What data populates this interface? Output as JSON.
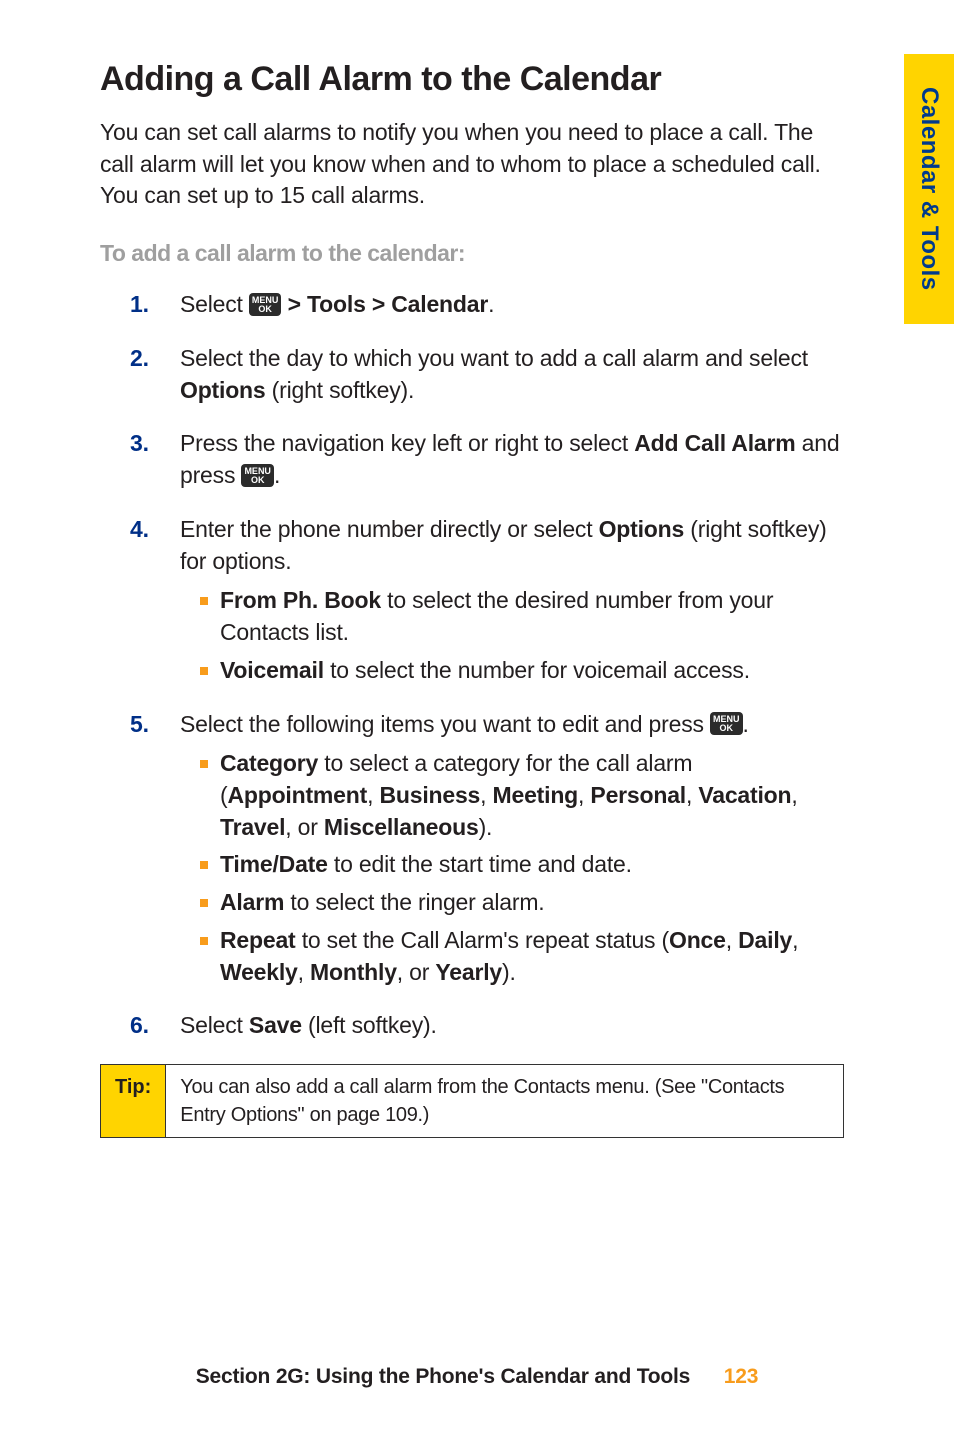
{
  "sideTab": "Calendar & Tools",
  "title": "Adding a Call Alarm to the Calendar",
  "intro": "You can set call alarms to notify you when you need to place a call. The call alarm will let you know when and to whom to place a scheduled call. You can set up to 15 call alarms.",
  "subheading": "To add a call alarm to the calendar:",
  "menuIcon": {
    "top": "MENU",
    "bot": "OK"
  },
  "steps": {
    "s1": {
      "prefix": "Select ",
      "suffix": " > Tools > Calendar",
      "trail": "."
    },
    "s2": {
      "l1": "Select the day to which you want to add a call alarm and select ",
      "opt": "Options",
      "l2": " (right softkey)."
    },
    "s3": {
      "l1": "Press the navigation key left or right to select ",
      "add": "Add Call Alarm",
      "l2": " and press ",
      "trail": "."
    },
    "s4": {
      "l1": "Enter the phone number directly or select ",
      "opt": "Options",
      "l2": " (right softkey) for options.",
      "a": {
        "bold": "From Ph. Book",
        "rest": " to select the desired number from your Contacts list."
      },
      "b": {
        "bold": "Voicemail",
        "rest": " to select the number for voicemail access."
      }
    },
    "s5": {
      "l1": "Select the following items you want to edit and press ",
      "trail": ".",
      "a": {
        "bold": "Category",
        "rest1": " to select a category for the call alarm (",
        "b1": "Appointment",
        "c": ", ",
        "b2": "Business",
        "b3": "Meeting",
        "b4": "Personal",
        "b5": "Vacation",
        "b6": "Travel",
        "or": ", or ",
        "b7": "Miscellaneous",
        "close": ")."
      },
      "b": {
        "bold": "Time/Date",
        "rest": " to edit the start time and date."
      },
      "c": {
        "bold": "Alarm",
        "rest": " to select the ringer alarm."
      },
      "d": {
        "bold": "Repeat",
        "rest1": " to set the Call Alarm's repeat status (",
        "b1": "Once",
        "c": ", ",
        "b2": "Daily",
        "b3": "Weekly",
        "b4": "Monthly",
        "or": ", or ",
        "b5": "Yearly",
        "close": ")."
      }
    },
    "s6": {
      "l1": "Select ",
      "save": "Save",
      "l2": " (left softkey)."
    }
  },
  "tip": {
    "label": "Tip:",
    "text": "You can also add a call alarm from the Contacts menu. (See \"Contacts Entry Options\" on page 109.)"
  },
  "footer": {
    "text": "Section 2G: Using the Phone's Calendar and Tools",
    "page": "123"
  }
}
